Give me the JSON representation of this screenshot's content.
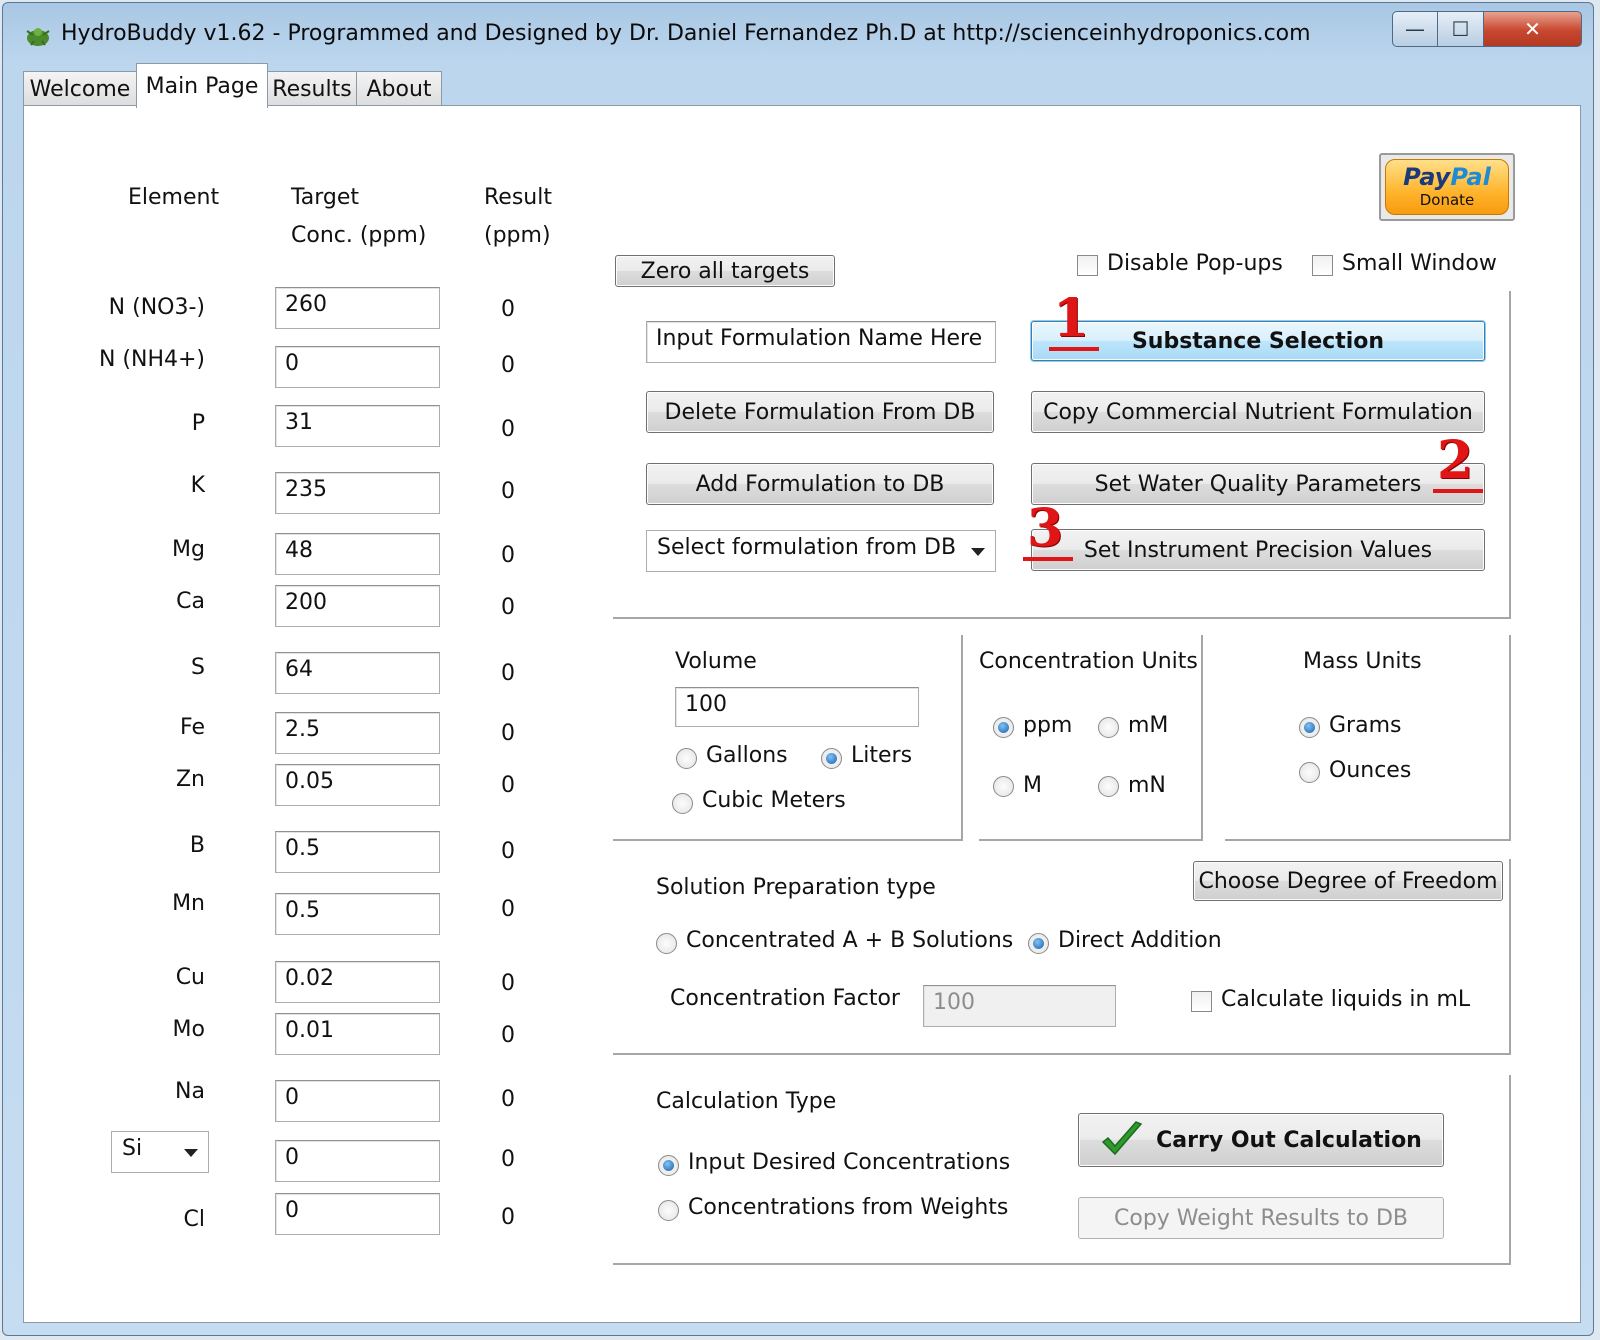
{
  "window": {
    "title": "HydroBuddy v1.62 - Programmed and Designed by Dr. Daniel Fernandez Ph.D at http://scienceinhydroponics.com",
    "controls": {
      "minimize": "—",
      "maximize": "☐",
      "close": "✕"
    }
  },
  "tabs": [
    "Welcome",
    "Main Page",
    "Results",
    "About"
  ],
  "active_tab": "Main Page",
  "elements_table": {
    "headers": {
      "element": "Element",
      "target_1": "Target",
      "target_2": "Conc. (ppm)",
      "result_1": "Result",
      "result_2": "(ppm)"
    },
    "rows": [
      {
        "element": "N (NO3-)",
        "target": "260",
        "result": "0"
      },
      {
        "element": "N (NH4+)",
        "target": "0",
        "result": "0"
      },
      {
        "element": "P",
        "target": "31",
        "result": "0"
      },
      {
        "element": "K",
        "target": "235",
        "result": "0"
      },
      {
        "element": "Mg",
        "target": "48",
        "result": "0"
      },
      {
        "element": "Ca",
        "target": "200",
        "result": "0"
      },
      {
        "element": "S",
        "target": "64",
        "result": "0"
      },
      {
        "element": "Fe",
        "target": "2.5",
        "result": "0"
      },
      {
        "element": "Zn",
        "target": "0.05",
        "result": "0"
      },
      {
        "element": "B",
        "target": "0.5",
        "result": "0"
      },
      {
        "element": "Mn",
        "target": "0.5",
        "result": "0"
      },
      {
        "element": "Cu",
        "target": "0.02",
        "result": "0"
      },
      {
        "element": "Mo",
        "target": "0.01",
        "result": "0"
      },
      {
        "element": "Na",
        "target": "0",
        "result": "0"
      },
      {
        "element": "Si",
        "target": "0",
        "result": "0"
      },
      {
        "element": "Cl",
        "target": "0",
        "result": "0"
      }
    ]
  },
  "paypal": {
    "logo_a": "Pay",
    "logo_b": "Pal",
    "donate": "Donate"
  },
  "top": {
    "zero_all_targets": "Zero all targets",
    "disable_popups": "Disable Pop-ups",
    "disable_popups_checked": false,
    "small_window": "Small Window",
    "small_window_checked": false
  },
  "formulation": {
    "name_input": "Input Formulation Name Here",
    "substance_selection": "Substance Selection",
    "delete_formulation": "Delete Formulation From DB",
    "copy_commercial": "Copy Commercial Nutrient Formulation",
    "add_formulation": "Add Formulation to DB",
    "set_water_quality": "Set Water Quality Parameters",
    "select_formulation": "Select formulation from DB",
    "set_instrument_precision": "Set Instrument Precision Values"
  },
  "annotations": {
    "one": "1",
    "two": "2",
    "three": "3",
    "color": "#e01515"
  },
  "volume": {
    "label": "Volume",
    "value": "100",
    "gallons": "Gallons",
    "liters": "Liters",
    "cubic_meters": "Cubic Meters",
    "selected": "Liters"
  },
  "concentration_units": {
    "label": "Concentration Units",
    "ppm": "ppm",
    "mM": "mM",
    "M": "M",
    "mN": "mN",
    "selected": "ppm"
  },
  "mass_units": {
    "label": "Mass Units",
    "grams": "Grams",
    "ounces": "Ounces",
    "selected": "Grams"
  },
  "solution_prep": {
    "label": "Solution Preparation type",
    "choose_dof": "Choose Degree of Freedom",
    "concentrated_ab": "Concentrated A + B Solutions",
    "direct_addition": "Direct Addition",
    "selected": "Direct Addition",
    "conc_factor_label": "Concentration Factor",
    "conc_factor_value": "100",
    "calc_liquids_ml": "Calculate liquids in mL",
    "calc_liquids_checked": false
  },
  "calculation": {
    "label": "Calculation Type",
    "input_desired": "Input Desired Concentrations",
    "from_weights": "Concentrations from  Weights",
    "selected": "Input Desired Concentrations",
    "carry_out": "Carry Out Calculation",
    "copy_weight_results": "Copy Weight Results to DB"
  },
  "colors": {
    "title_bar": "#bcd6ee",
    "focus_button": "#bee6fd",
    "close_button": "#c8472f",
    "checkmark": "#2e9a2e"
  }
}
